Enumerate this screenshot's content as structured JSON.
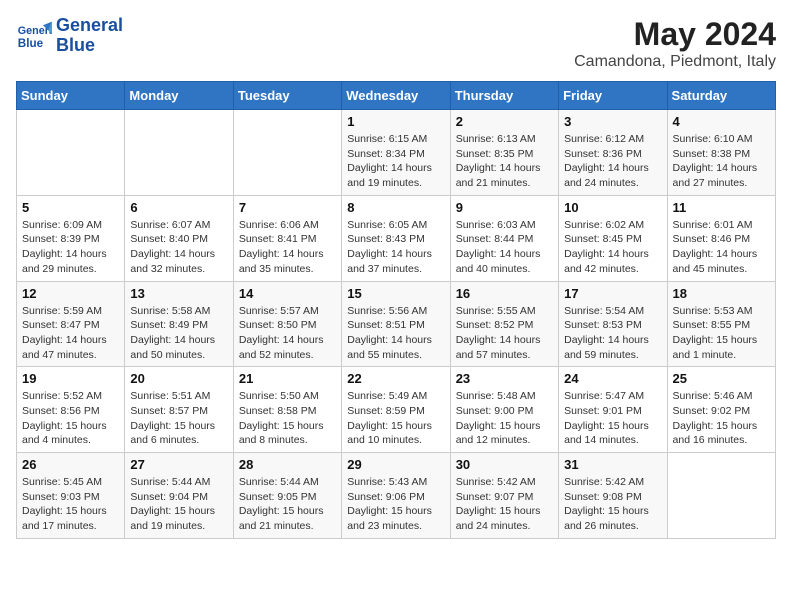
{
  "header": {
    "logo_line1": "General",
    "logo_line2": "Blue",
    "title": "May 2024",
    "subtitle": "Camandona, Piedmont, Italy"
  },
  "days_of_week": [
    "Sunday",
    "Monday",
    "Tuesday",
    "Wednesday",
    "Thursday",
    "Friday",
    "Saturday"
  ],
  "weeks": [
    {
      "days": [
        {
          "num": "",
          "info": ""
        },
        {
          "num": "",
          "info": ""
        },
        {
          "num": "",
          "info": ""
        },
        {
          "num": "1",
          "info": "Sunrise: 6:15 AM\nSunset: 8:34 PM\nDaylight: 14 hours and 19 minutes."
        },
        {
          "num": "2",
          "info": "Sunrise: 6:13 AM\nSunset: 8:35 PM\nDaylight: 14 hours and 21 minutes."
        },
        {
          "num": "3",
          "info": "Sunrise: 6:12 AM\nSunset: 8:36 PM\nDaylight: 14 hours and 24 minutes."
        },
        {
          "num": "4",
          "info": "Sunrise: 6:10 AM\nSunset: 8:38 PM\nDaylight: 14 hours and 27 minutes."
        }
      ]
    },
    {
      "days": [
        {
          "num": "5",
          "info": "Sunrise: 6:09 AM\nSunset: 8:39 PM\nDaylight: 14 hours and 29 minutes."
        },
        {
          "num": "6",
          "info": "Sunrise: 6:07 AM\nSunset: 8:40 PM\nDaylight: 14 hours and 32 minutes."
        },
        {
          "num": "7",
          "info": "Sunrise: 6:06 AM\nSunset: 8:41 PM\nDaylight: 14 hours and 35 minutes."
        },
        {
          "num": "8",
          "info": "Sunrise: 6:05 AM\nSunset: 8:43 PM\nDaylight: 14 hours and 37 minutes."
        },
        {
          "num": "9",
          "info": "Sunrise: 6:03 AM\nSunset: 8:44 PM\nDaylight: 14 hours and 40 minutes."
        },
        {
          "num": "10",
          "info": "Sunrise: 6:02 AM\nSunset: 8:45 PM\nDaylight: 14 hours and 42 minutes."
        },
        {
          "num": "11",
          "info": "Sunrise: 6:01 AM\nSunset: 8:46 PM\nDaylight: 14 hours and 45 minutes."
        }
      ]
    },
    {
      "days": [
        {
          "num": "12",
          "info": "Sunrise: 5:59 AM\nSunset: 8:47 PM\nDaylight: 14 hours and 47 minutes."
        },
        {
          "num": "13",
          "info": "Sunrise: 5:58 AM\nSunset: 8:49 PM\nDaylight: 14 hours and 50 minutes."
        },
        {
          "num": "14",
          "info": "Sunrise: 5:57 AM\nSunset: 8:50 PM\nDaylight: 14 hours and 52 minutes."
        },
        {
          "num": "15",
          "info": "Sunrise: 5:56 AM\nSunset: 8:51 PM\nDaylight: 14 hours and 55 minutes."
        },
        {
          "num": "16",
          "info": "Sunrise: 5:55 AM\nSunset: 8:52 PM\nDaylight: 14 hours and 57 minutes."
        },
        {
          "num": "17",
          "info": "Sunrise: 5:54 AM\nSunset: 8:53 PM\nDaylight: 14 hours and 59 minutes."
        },
        {
          "num": "18",
          "info": "Sunrise: 5:53 AM\nSunset: 8:55 PM\nDaylight: 15 hours and 1 minute."
        }
      ]
    },
    {
      "days": [
        {
          "num": "19",
          "info": "Sunrise: 5:52 AM\nSunset: 8:56 PM\nDaylight: 15 hours and 4 minutes."
        },
        {
          "num": "20",
          "info": "Sunrise: 5:51 AM\nSunset: 8:57 PM\nDaylight: 15 hours and 6 minutes."
        },
        {
          "num": "21",
          "info": "Sunrise: 5:50 AM\nSunset: 8:58 PM\nDaylight: 15 hours and 8 minutes."
        },
        {
          "num": "22",
          "info": "Sunrise: 5:49 AM\nSunset: 8:59 PM\nDaylight: 15 hours and 10 minutes."
        },
        {
          "num": "23",
          "info": "Sunrise: 5:48 AM\nSunset: 9:00 PM\nDaylight: 15 hours and 12 minutes."
        },
        {
          "num": "24",
          "info": "Sunrise: 5:47 AM\nSunset: 9:01 PM\nDaylight: 15 hours and 14 minutes."
        },
        {
          "num": "25",
          "info": "Sunrise: 5:46 AM\nSunset: 9:02 PM\nDaylight: 15 hours and 16 minutes."
        }
      ]
    },
    {
      "days": [
        {
          "num": "26",
          "info": "Sunrise: 5:45 AM\nSunset: 9:03 PM\nDaylight: 15 hours and 17 minutes."
        },
        {
          "num": "27",
          "info": "Sunrise: 5:44 AM\nSunset: 9:04 PM\nDaylight: 15 hours and 19 minutes."
        },
        {
          "num": "28",
          "info": "Sunrise: 5:44 AM\nSunset: 9:05 PM\nDaylight: 15 hours and 21 minutes."
        },
        {
          "num": "29",
          "info": "Sunrise: 5:43 AM\nSunset: 9:06 PM\nDaylight: 15 hours and 23 minutes."
        },
        {
          "num": "30",
          "info": "Sunrise: 5:42 AM\nSunset: 9:07 PM\nDaylight: 15 hours and 24 minutes."
        },
        {
          "num": "31",
          "info": "Sunrise: 5:42 AM\nSunset: 9:08 PM\nDaylight: 15 hours and 26 minutes."
        },
        {
          "num": "",
          "info": ""
        }
      ]
    }
  ]
}
